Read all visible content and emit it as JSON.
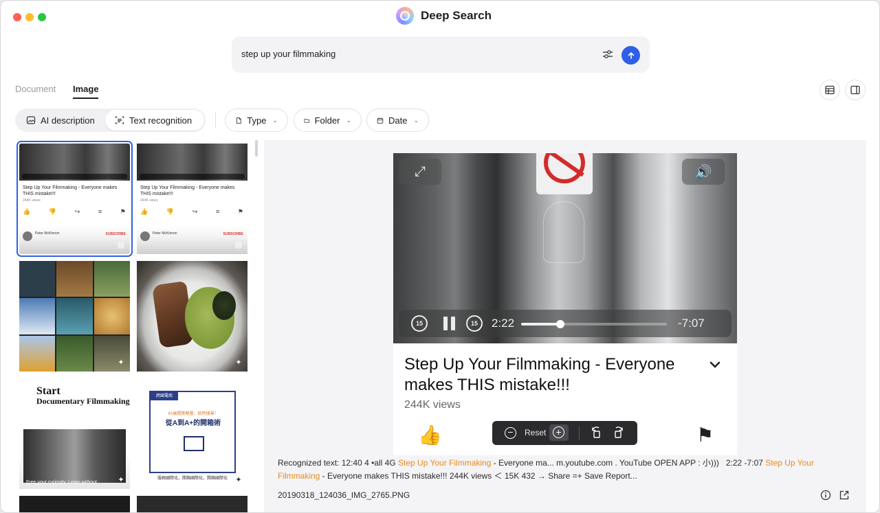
{
  "app": {
    "title": "Deep Search"
  },
  "search": {
    "query": "step up your filmmaking"
  },
  "tabs": [
    {
      "label": "Document",
      "active": false
    },
    {
      "label": "Image",
      "active": true
    }
  ],
  "filters": {
    "ai_description": "AI description",
    "text_recognition": "Text recognition",
    "type": "Type",
    "folder": "Folder",
    "date": "Date"
  },
  "thumbnails": {
    "yt_title": "Step Up Your Filmmaking - Everyone makes THIS mistake!!!",
    "yt_views": "244K views",
    "yt_channel": "Peter McKinnon",
    "yt_subscribe": "SUBSCRIBE",
    "doc1_title_line1": "Start",
    "doc1_title_line2": "Documentary Filmmaking",
    "doc1_footer": "Free your curiosity. Learn without",
    "doc2_tag": "跨國電商",
    "doc2_line1": "4S展開策略圖，既時搜尋！",
    "doc2_line2": "從A到A+的開箱術",
    "doc2_bottom": "服務國際化，開箱國際化，開箱國際化"
  },
  "preview": {
    "video_time_current": "2:22",
    "video_time_remaining": "-7:07",
    "rewind_label": "15",
    "forward_label": "15",
    "progress": 0.27,
    "title": "Step Up Your Filmmaking - Everyone makes THIS mistake!!!",
    "views": "244K views"
  },
  "zoom": {
    "reset_label": "Reset"
  },
  "recognized": {
    "prefix": "Recognized text: 12:40 4 •all 4G ",
    "hl1": "Step Up Your Filmmaking",
    "mid": " - Everyone ma... m.youtube.com . YouTube OPEN APP : 小)))   2:22 -7:07 ",
    "hl2": "Step Up Your Filmmaking",
    "suffix": " - Everyone makes THIS mistake!!! 244K views ＜ 15K 432 → Share =+ Save Report..."
  },
  "file": {
    "name": "20190318_124036_IMG_2765.PNG"
  },
  "colors": {
    "accent": "#2f5fe6",
    "highlight": "#e88a1a"
  }
}
